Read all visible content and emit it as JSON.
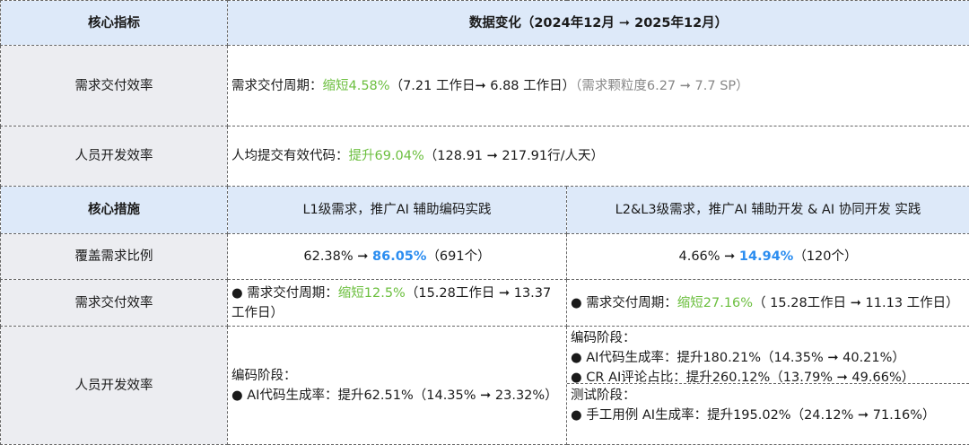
{
  "header": {
    "col1": "核心指标",
    "col2": "数据变化（2024年12月 ➞ 2025年12月）"
  },
  "metrics": [
    {
      "label": "需求交付效率",
      "prefix": "需求交付周期：",
      "highlight": "缩短4.58%",
      "detail": "（7.21 工作日➞ 6.88 工作日）",
      "note": "（需求颗粒度6.27 ➞ 7.7 SP）"
    },
    {
      "label": "人员开发效率",
      "prefix": "人均提交有效代码：",
      "highlight": "提升69.04%",
      "detail": "（128.91 ➞ 217.91行/人天）"
    }
  ],
  "measures_header": {
    "col1": "核心措施",
    "col2": "L1级需求，推广AI 辅助编码实践",
    "col3": "L2&L3级需求，推广AI 辅助开发 & AI 协同开发 实践"
  },
  "coverage": {
    "label": "覆盖需求比例",
    "l1": {
      "from": "62.38% ➞ ",
      "to": "86.05%",
      "count": "（691个）"
    },
    "l23": {
      "from": "4.66% ➞ ",
      "to": "14.94%",
      "count": "（120个）"
    }
  },
  "delivery": {
    "label": "需求交付效率",
    "l1": {
      "prefix": "● 需求交付周期：",
      "highlight": "缩短12.5%",
      "detail": "（15.28工作日 ➞ 13.37工作日）"
    },
    "l23": {
      "prefix": "● 需求交付周期：",
      "highlight": "缩短27.16%",
      "detail": "（ 15.28工作日 ➞ 11.13 工作日）"
    }
  },
  "dev": {
    "label": "人员开发效率",
    "l1": {
      "stage": "编码阶段：",
      "items": [
        "● AI代码生成率：提升62.51%（14.35% ➞ 23.32%）"
      ]
    },
    "l23": {
      "coding_stage": "编码阶段：",
      "coding_items": [
        "● AI代码生成率：提升180.21%（14.35% ➞ 40.21%）",
        "● CR AI评论占比：提升260.12%（13.79% ➞ 49.66%）"
      ],
      "testing_stage": "测试阶段：",
      "testing_items": [
        "● 手工用例 AI生成率：提升195.02%（24.12% ➞ 71.16%）"
      ]
    }
  }
}
